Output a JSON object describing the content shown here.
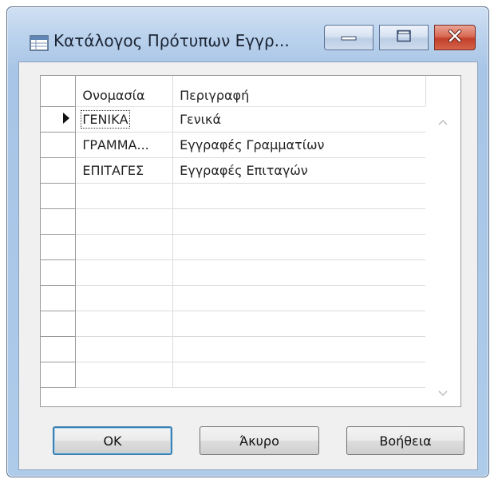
{
  "window": {
    "title": "Κατάλογος Πρότυπων Εγγρ...",
    "icon": "table-window-icon",
    "controls": [
      "minimize-icon",
      "maximize-icon",
      "close-icon"
    ]
  },
  "grid": {
    "columns": [
      "Ονομασία",
      "Περιγραφή"
    ],
    "rows": [
      {
        "name": "ΓΕΝΙΚΑ",
        "description": "Γενικά"
      },
      {
        "name": "ΓΡΑΜΜΑ...",
        "description": "Εγγραφές Γραμματίων"
      },
      {
        "name": "ΕΠΙΤΑΓΕΣ",
        "description": "Εγγραφές Επιταγών"
      }
    ],
    "empty_row_count": 8,
    "selected_row_index": 0
  },
  "buttons": {
    "ok": "OK",
    "cancel": "Άκυρο",
    "help": "Βοήθεια"
  },
  "colors": {
    "window_frame": "#b9d1ec",
    "close_button": "#c2402a",
    "default_button_border": "#3c7fb1"
  }
}
